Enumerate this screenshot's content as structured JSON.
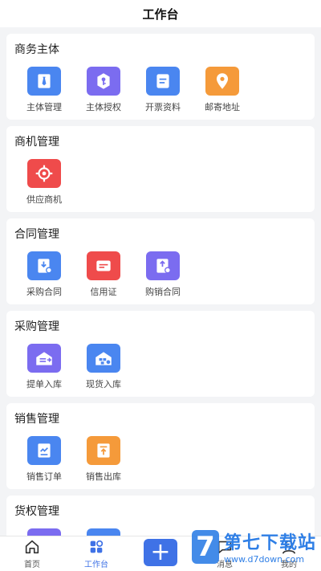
{
  "header": {
    "title": "工作台"
  },
  "colors": {
    "blue": "#4a86f0",
    "purple": "#7b6cf0",
    "orange": "#f59a3a",
    "red": "#ef4b4b",
    "accent": "#3f72e6"
  },
  "sections": [
    {
      "title": "商务主体",
      "items": [
        {
          "label": "主体管理",
          "icon": "tie-icon",
          "color": "#4a86f0"
        },
        {
          "label": "主体授权",
          "icon": "key-shield-icon",
          "color": "#7b6cf0"
        },
        {
          "label": "开票资料",
          "icon": "document-icon",
          "color": "#4a86f0"
        },
        {
          "label": "邮寄地址",
          "icon": "location-pin-icon",
          "color": "#f59a3a"
        }
      ]
    },
    {
      "title": "商机管理",
      "items": [
        {
          "label": "供应商机",
          "icon": "target-icon",
          "color": "#ef4b4b"
        }
      ]
    },
    {
      "title": "合同管理",
      "items": [
        {
          "label": "采购合同",
          "icon": "download-contract-icon",
          "color": "#4a86f0"
        },
        {
          "label": "信用证",
          "icon": "card-icon",
          "color": "#ef4b4b"
        },
        {
          "label": "购销合同",
          "icon": "upload-contract-icon",
          "color": "#7b6cf0"
        }
      ]
    },
    {
      "title": "采购管理",
      "items": [
        {
          "label": "提单入库",
          "icon": "warehouse-in-icon",
          "color": "#7b6cf0"
        },
        {
          "label": "现货入库",
          "icon": "warehouse-stock-icon",
          "color": "#4a86f0"
        }
      ]
    },
    {
      "title": "销售管理",
      "items": [
        {
          "label": "销售订单",
          "icon": "chart-order-icon",
          "color": "#4a86f0"
        },
        {
          "label": "销售出库",
          "icon": "outbound-icon",
          "color": "#f59a3a"
        }
      ]
    },
    {
      "title": "货权管理",
      "items": [
        {
          "label": "",
          "icon": "box-icon",
          "color": "#7b6cf0"
        },
        {
          "label": "",
          "icon": "box-icon",
          "color": "#4a86f0"
        }
      ]
    }
  ],
  "tabbar": {
    "tabs": [
      {
        "label": "首页",
        "icon": "home-icon"
      },
      {
        "label": "工作台",
        "icon": "grid-icon"
      },
      {
        "label": "消息",
        "icon": "message-icon"
      },
      {
        "label": "我的",
        "icon": "user-icon"
      }
    ],
    "fab_label": "+"
  },
  "watermark": {
    "mark": "7",
    "text": "第七下载站",
    "url": "www.d7down.com"
  }
}
